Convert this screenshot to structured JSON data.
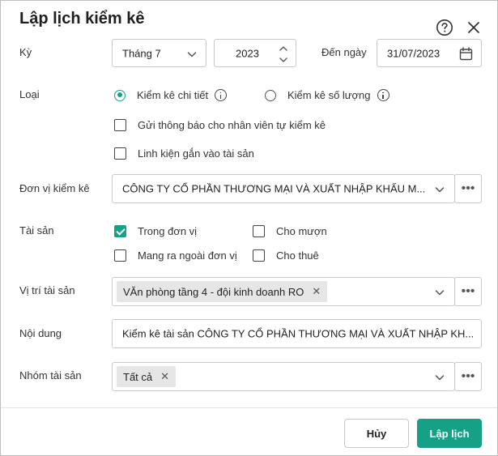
{
  "dialog": {
    "title": "Lập lịch kiểm kê"
  },
  "period": {
    "label": "Kỳ",
    "month_value": "Tháng 7",
    "year_value": "2023",
    "to_date_label": "Đến ngày",
    "to_date_value": "31/07/2023"
  },
  "type": {
    "label": "Loại",
    "option_detail": "Kiểm kê chi tiết",
    "option_quantity": "Kiểm kê số lượng",
    "selected": "detail",
    "notify_label": "Gửi thông báo cho nhân viên tự kiểm kê",
    "notify_checked": false,
    "component_label": "Linh kiện gắn vào tài sản",
    "component_checked": false
  },
  "unit": {
    "label": "Đơn vị kiểm kê",
    "value": "CÔNG TY CỔ PHẦN THƯƠNG MẠI VÀ XUẤT NHẬP KHẨU M..."
  },
  "assets": {
    "label": "Tài sản",
    "in_unit_label": "Trong đơn vị",
    "in_unit_checked": true,
    "borrowed_label": "Cho mượn",
    "borrowed_checked": false,
    "taken_out_label": "Mang ra ngoài đơn vị",
    "taken_out_checked": false,
    "rented_label": "Cho thuê",
    "rented_checked": false
  },
  "location": {
    "label": "Vị trí tài sản",
    "tag": "VĂn phòng tầng 4 - đội kinh doanh RO"
  },
  "content": {
    "label": "Nội dung",
    "value": "Kiểm kê tài sản CÔNG TY CỔ PHẦN THƯƠNG MẠI VÀ XUẤT NHẬP KH..."
  },
  "asset_group": {
    "label": "Nhóm tài sản",
    "tag": "Tất cả"
  },
  "footer": {
    "cancel_label": "Hủy",
    "submit_label": "Lập lịch"
  },
  "icons": {
    "help": "help-circle-icon",
    "close": "close-icon",
    "calendar": "calendar-icon",
    "chevron": "chevron-down-icon",
    "more": "more-horizontal-icon",
    "info": "info-icon"
  },
  "colors": {
    "accent": "#16a085",
    "border": "#c9c9c9"
  }
}
